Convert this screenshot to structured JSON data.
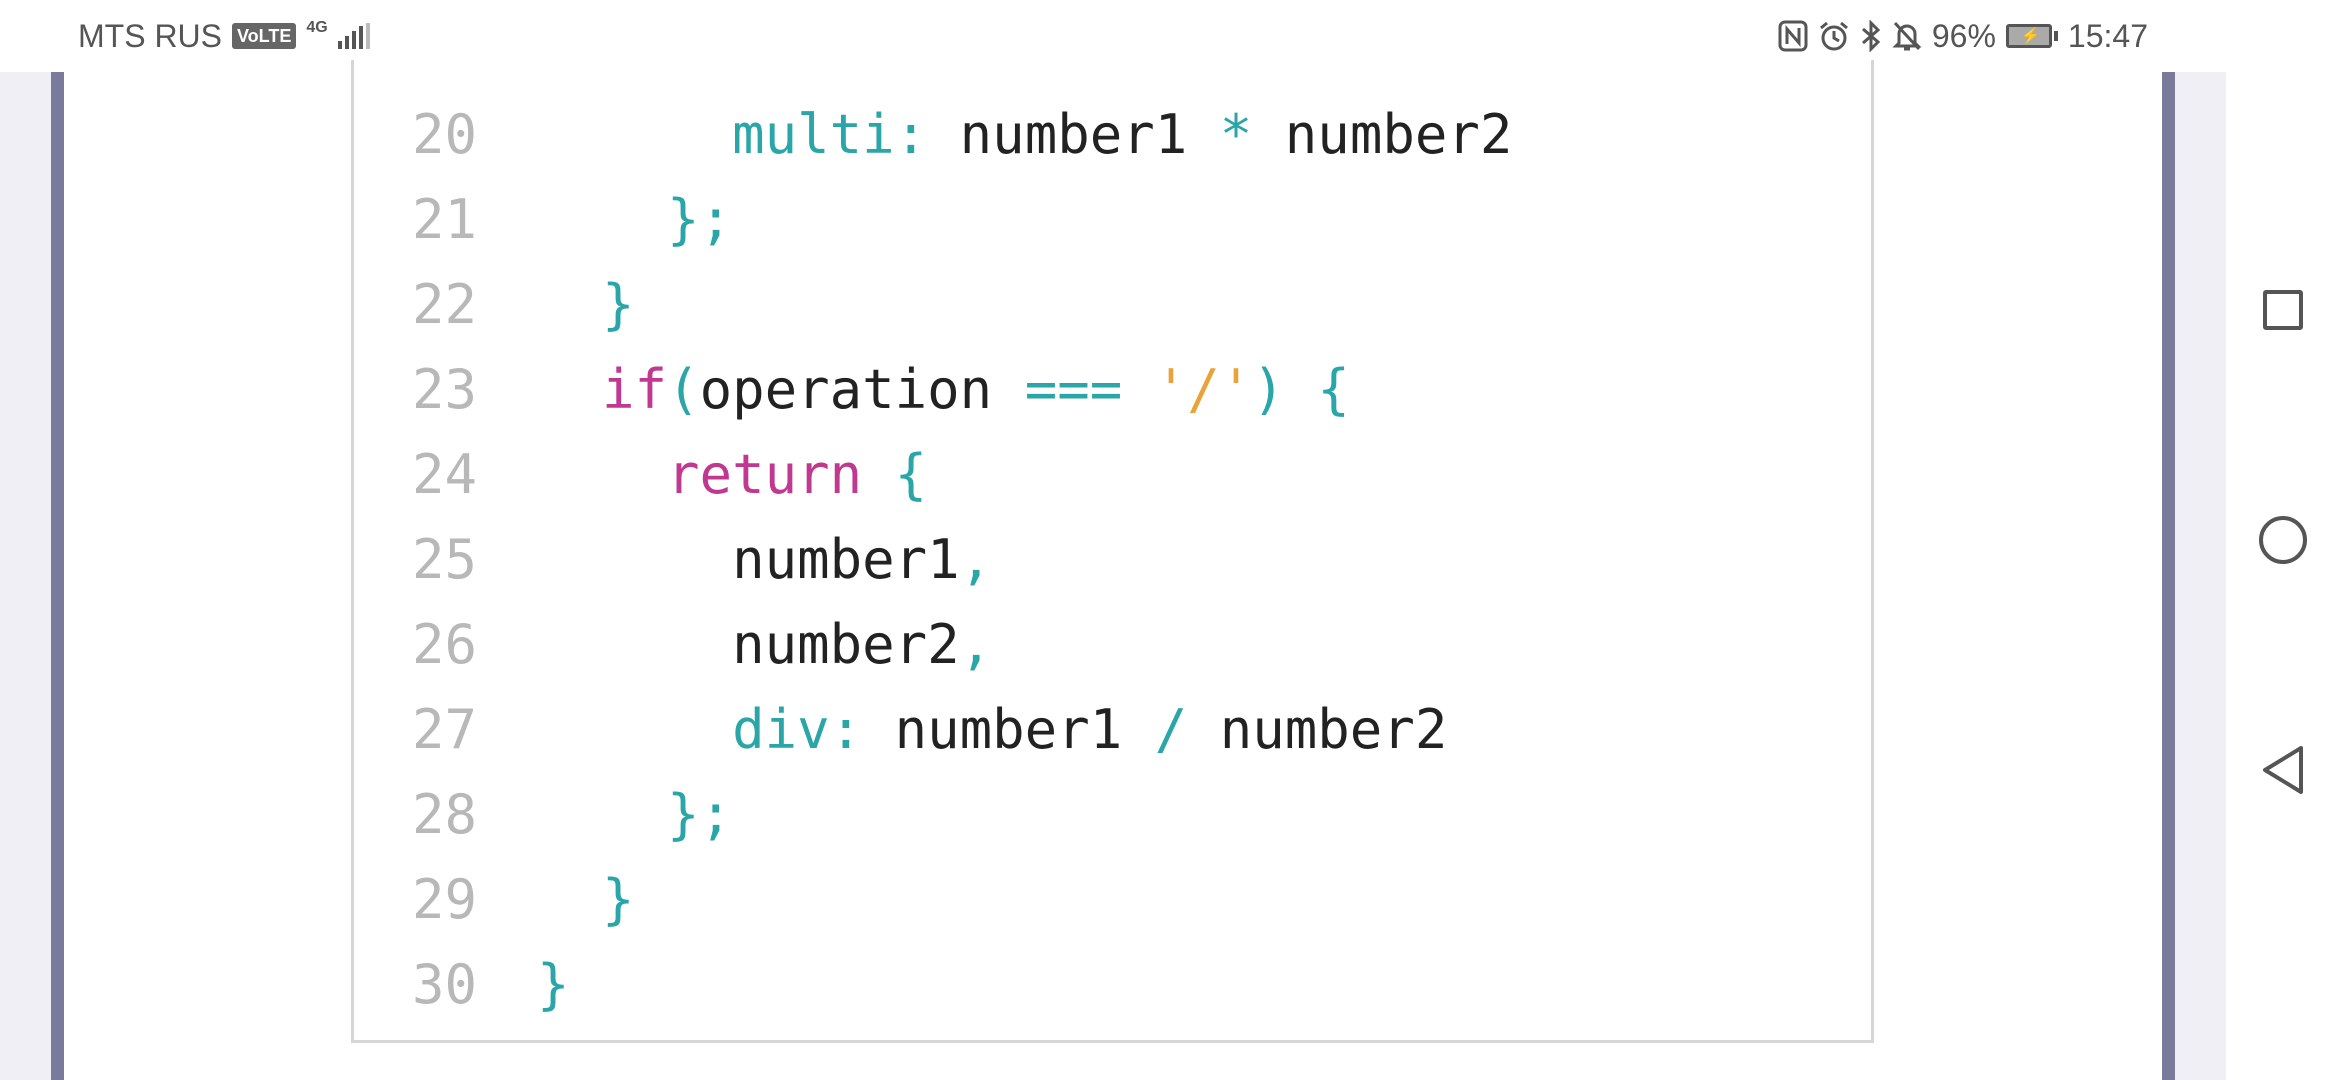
{
  "status_bar": {
    "carrier": "MTS RUS",
    "volte": "VoLTE",
    "network": "4G",
    "battery_percent": "96%",
    "time": "15:47",
    "icons": [
      "nfc-icon",
      "alarm-icon",
      "bluetooth-icon",
      "silent-bell-icon",
      "battery-charging-icon"
    ]
  },
  "code_block": {
    "lines": [
      {
        "num": "20",
        "indent": "      ",
        "tokens": [
          {
            "t": "multi:",
            "c": "p"
          },
          {
            "t": " number1 ",
            "c": ""
          },
          {
            "t": "*",
            "c": "p"
          },
          {
            "t": " number2",
            "c": ""
          }
        ]
      },
      {
        "num": "21",
        "indent": "    ",
        "tokens": [
          {
            "t": "};",
            "c": "p"
          }
        ]
      },
      {
        "num": "22",
        "indent": "  ",
        "tokens": [
          {
            "t": "}",
            "c": "p"
          }
        ]
      },
      {
        "num": "23",
        "indent": "  ",
        "tokens": [
          {
            "t": "if",
            "c": "kw"
          },
          {
            "t": "(",
            "c": "p"
          },
          {
            "t": "operation ",
            "c": ""
          },
          {
            "t": "===",
            "c": "p"
          },
          {
            "t": " ",
            "c": ""
          },
          {
            "t": "'/'",
            "c": "str"
          },
          {
            "t": ")",
            "c": "p"
          },
          {
            "t": " ",
            "c": ""
          },
          {
            "t": "{",
            "c": "p"
          }
        ]
      },
      {
        "num": "24",
        "indent": "    ",
        "tokens": [
          {
            "t": "return",
            "c": "kw"
          },
          {
            "t": " ",
            "c": ""
          },
          {
            "t": "{",
            "c": "p"
          }
        ]
      },
      {
        "num": "25",
        "indent": "      ",
        "tokens": [
          {
            "t": "number1",
            "c": ""
          },
          {
            "t": ",",
            "c": "p"
          }
        ]
      },
      {
        "num": "26",
        "indent": "      ",
        "tokens": [
          {
            "t": "number2",
            "c": ""
          },
          {
            "t": ",",
            "c": "p"
          }
        ]
      },
      {
        "num": "27",
        "indent": "      ",
        "tokens": [
          {
            "t": "div:",
            "c": "p"
          },
          {
            "t": " number1 ",
            "c": ""
          },
          {
            "t": "/",
            "c": "p"
          },
          {
            "t": " number2",
            "c": ""
          }
        ]
      },
      {
        "num": "28",
        "indent": "    ",
        "tokens": [
          {
            "t": "};",
            "c": "p"
          }
        ]
      },
      {
        "num": "29",
        "indent": "  ",
        "tokens": [
          {
            "t": "}",
            "c": "p"
          }
        ]
      },
      {
        "num": "30",
        "indent": "",
        "tokens": [
          {
            "t": "}",
            "c": "p"
          }
        ]
      }
    ]
  },
  "nav_bar": {
    "buttons": [
      "recent-apps-icon",
      "home-icon",
      "back-icon"
    ]
  },
  "colors": {
    "punctuation": "#2aa6a8",
    "keyword": "#c0388f",
    "string": "#e8a33a",
    "line_number": "#b8b8b8",
    "page_border": "#7a7a9a"
  }
}
